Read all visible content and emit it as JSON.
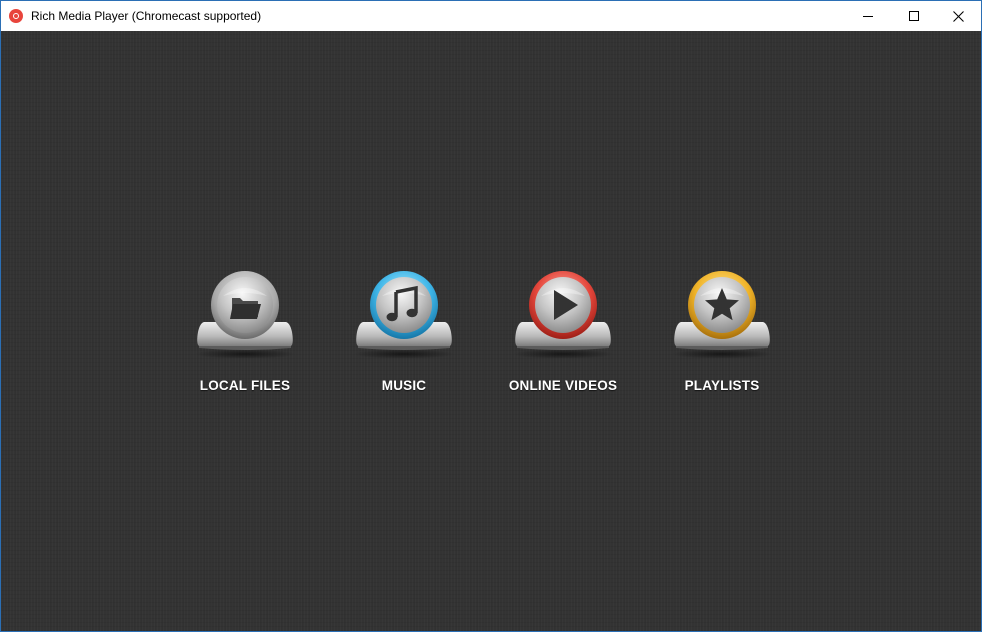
{
  "window": {
    "title": "Rich Media Player (Chromecast supported)",
    "controls": {
      "minimize": "minimize-icon",
      "maximize": "maximize-icon",
      "close": "close-icon"
    }
  },
  "menu": {
    "items": [
      {
        "label": "LOCAL FILES",
        "icon": "folder-icon",
        "accent": "#9a9a9a"
      },
      {
        "label": "MUSIC",
        "icon": "music-note-icon",
        "accent": "#3fb6e8"
      },
      {
        "label": "ONLINE VIDEOS",
        "icon": "play-icon",
        "accent": "#e5473c"
      },
      {
        "label": "PLAYLISTS",
        "icon": "star-icon",
        "accent": "#f0b429"
      }
    ]
  },
  "colors": {
    "background": "#333333",
    "label": "#ffffff",
    "window_border": "#2b6fb5"
  }
}
